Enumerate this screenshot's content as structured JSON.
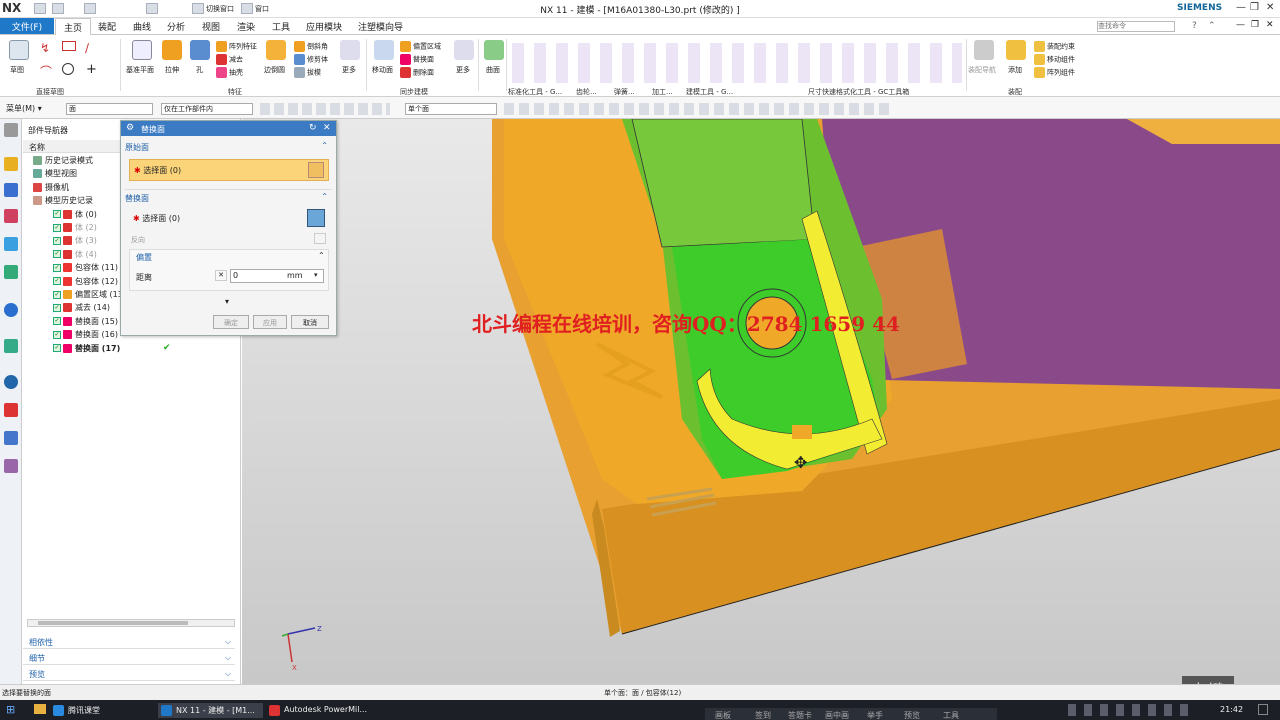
{
  "titlebar": {
    "logo": "NX",
    "quick_switch_window": "切换窗口",
    "quick_window": "窗口",
    "title": "NX 11 - 建模 - [M16A01380-L30.prt  (修改的) ]",
    "brand": "SIEMENS"
  },
  "menubar": {
    "file": "文件(F)",
    "tabs": [
      "主页",
      "装配",
      "曲线",
      "分析",
      "视图",
      "渲染",
      "工具",
      "应用模块",
      "注塑模向导"
    ],
    "search_placeholder": "查找命令"
  },
  "ribbon": {
    "sketch": "草图",
    "groups": {
      "direct_sketch": "直接草图",
      "feature": "特征",
      "sync_modeling": "同步建模",
      "std_tools": "标准化工具 - G...",
      "gear": "齿轮...",
      "spring": "弹簧...",
      "machining": "加工...",
      "mold_tools": "建模工具 - G...",
      "dim_tools": "尺寸快速格式化工具 - GC工具箱",
      "assembly": "装配"
    },
    "datum_plane": "基准平面",
    "extrude": "拉伸",
    "hole": "孔",
    "pattern_feature": "阵列特征",
    "subtract": "减去",
    "shell": "抽壳",
    "edge_blend": "边倒圆",
    "chamfer": "倒斜角",
    "trim_body": "修剪体",
    "draft": "拔模",
    "more": "更多",
    "move_face": "移动面",
    "offset_region": "偏置区域",
    "replace_face": "替换面",
    "delete_face": "删除面",
    "more2": "更多",
    "surface": "曲面",
    "assembly_constraint": "装配约束",
    "move_component": "移动组件",
    "pattern_component": "阵列组件",
    "add": "添加",
    "assembly_nav": "装配导航"
  },
  "selection_bar": {
    "menu": "菜单(M)",
    "type_filter": "面",
    "scope": "仅在工作部件内",
    "face_rule": "单个面"
  },
  "navigator": {
    "title": "部件导航器",
    "column_name": "名称",
    "items": [
      {
        "label": "历史记录模式",
        "indent": 0
      },
      {
        "label": "模型视图",
        "indent": 0
      },
      {
        "label": "摄像机",
        "indent": 0
      },
      {
        "label": "模型历史记录",
        "indent": 0
      },
      {
        "label": "体 (0)",
        "indent": 1
      },
      {
        "label": "体 (2)",
        "indent": 1
      },
      {
        "label": "体 (3)",
        "indent": 1
      },
      {
        "label": "体 (4)",
        "indent": 1
      },
      {
        "label": "包容体 (11)",
        "indent": 1
      },
      {
        "label": "包容体 (12)",
        "indent": 1
      },
      {
        "label": "偏置区域 (13)",
        "indent": 1
      },
      {
        "label": "减去 (14)",
        "indent": 1
      },
      {
        "label": "替换面 (15)",
        "indent": 1
      },
      {
        "label": "替换面 (16)",
        "indent": 1
      },
      {
        "label": "替换面 (17)",
        "indent": 1
      }
    ],
    "panels": [
      "相依性",
      "细节",
      "预览"
    ]
  },
  "dialog": {
    "title": "替换面",
    "original_section": "原始面",
    "select_face_orig": "选择面 (0)",
    "replacement_section": "替换面",
    "select_face_repl": "选择面 (0)",
    "reverse": "反向",
    "offset_section": "偏置",
    "distance_label": "距离",
    "distance_value": "0",
    "distance_unit": "mm",
    "ok": "确定",
    "apply": "应用",
    "cancel": "取消"
  },
  "viewport": {
    "watermark": "北斗编程在线培训，咨询QQ：2784 1659 44",
    "triad_z": "Z",
    "triad_x": "X",
    "left_key": "左键"
  },
  "statusbar": {
    "left": "选择要替换的面",
    "center": "单个面：面 / 包容体(12)"
  },
  "taskbar": {
    "items": [
      "腾讯课堂",
      "NX 11 - 建模 - [M1...",
      "Autodesk PowerMil..."
    ],
    "tray": [
      "画板",
      "签到",
      "答题卡",
      "画中画",
      "举手",
      "预览",
      "工具"
    ],
    "time": "21:42"
  },
  "colors": {
    "accent": "#1f78c8",
    "model_orange": "#f0a020",
    "model_green": "#6cc030",
    "model_purple": "#8a4a8a",
    "highlight_yellow": "#f0ee30",
    "watermark_red": "#e02020"
  }
}
